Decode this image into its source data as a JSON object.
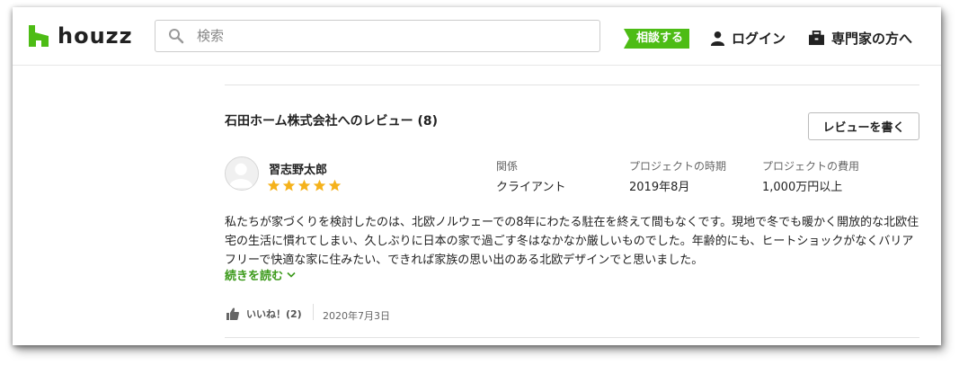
{
  "header": {
    "logo_text": "houzz",
    "search_placeholder": "検索",
    "consult_label": "相談する",
    "login_label": "ログイン",
    "pro_label": "専門家の方へ",
    "brand_color": "#4dbc15"
  },
  "reviews": {
    "section_title": "石田ホーム株式会社へのレビュー (8)",
    "write_button": "レビューを書く",
    "review": {
      "reviewer": "習志野太郎",
      "rating": 5,
      "rating_max": 5,
      "relation_label": "関係",
      "relation_value": "クライアント",
      "period_label": "プロジェクトの時期",
      "period_value": "2019年8月",
      "cost_label": "プロジェクトの費用",
      "cost_value": "1,000万円以上",
      "text": "私たちが家づくりを検討したのは、北欧ノルウェーでの8年にわたる駐在を終えて間もなくです。現地で冬でも暖かく開放的な北欧住宅の生活に慣れてしまい、久しぶりに日本の家で過ごす冬はなかなか厳しいものでした。年齢的にも、ヒートショックがなくバリアフリーで快適な家に住みたい、できれば家族の思い出のある北欧デザインでと思いました。",
      "read_more": "続きを読む",
      "like_label": "いいね！(2)",
      "date": "2020年7月3日"
    }
  }
}
